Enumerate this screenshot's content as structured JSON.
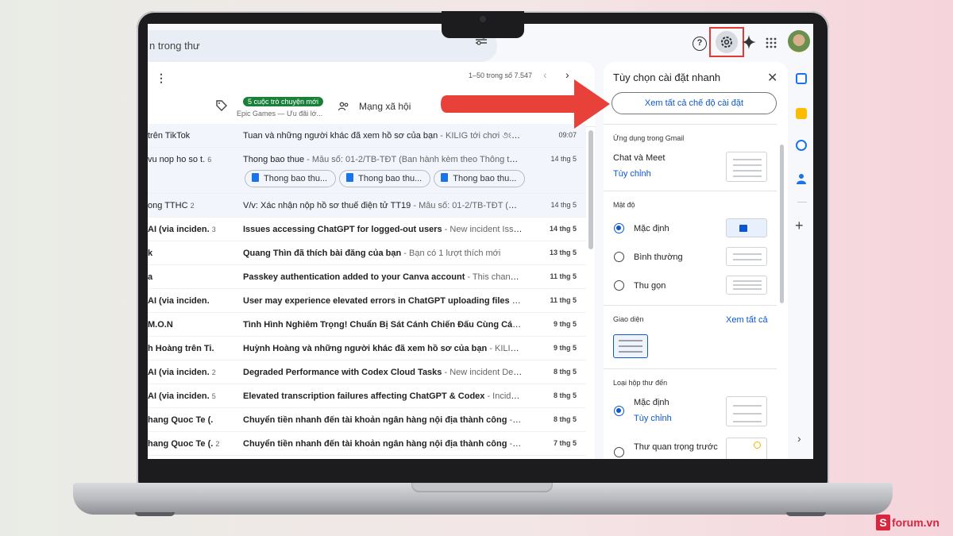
{
  "search": {
    "text": "n trong thư"
  },
  "list": {
    "pager": "1–50 trong số 7.547",
    "tabs": {
      "promo_badge": "5 cuộc trò chuyện mới",
      "promo_sub": "Epic Games — Ưu đãi lớ...",
      "social": "Mạng xã hội"
    },
    "rows": [
      {
        "sender": "trên TikTok",
        "count": "",
        "subject": "Tuan và những người khác đã xem hồ sơ của bạn",
        "snippet": " - KILIG tới chơi ૭ଽ ơi, hồ ...",
        "date": "09:07",
        "unread": false
      },
      {
        "sender": "vu nop ho so t.",
        "count": "6",
        "subject": "Thong bao thue",
        "snippet": " - Mẫu số: 01-2/TB-TĐT (Ban hành kèm theo Thông tư số 1...",
        "date": "14 thg 5",
        "unread": false
      },
      {
        "sender": "ong TTHC",
        "count": "2",
        "subject": "V/v: Xác nhận nộp hồ sơ thuế điện tử TT19",
        "snippet": " - Mẫu số: 01-2/TB-TĐT (Ban hàn...",
        "date": "14 thg 5",
        "unread": false
      },
      {
        "sender": "AI (via inciden.",
        "count": "3",
        "subject": "Issues accessing ChatGPT for logged-out users",
        "snippet": " - New incident Issues a...",
        "date": "14 thg 5",
        "unread": true
      },
      {
        "sender": "k",
        "count": "",
        "subject": "Quang Thìn đã thích bài đăng của bạn",
        "snippet": " - Bạn có 1 lượt thích mới",
        "date": "13 thg 5",
        "unread": true
      },
      {
        "sender": "a",
        "count": "",
        "subject": "Passkey authentication added to your Canva account",
        "snippet": " - This change is ...",
        "date": "11 thg 5",
        "unread": true
      },
      {
        "sender": "AI (via inciden.",
        "count": "",
        "subject": "User may experience elevated errors in ChatGPT uploading files and ...",
        "snippet": "",
        "date": "11 thg 5",
        "unread": true
      },
      {
        "sender": "M.O.N",
        "count": "",
        "subject": "Tình Hình Nghiêm Trọng! Chuẩn Bị Sát Cánh Chiến Đấu Cùng Các Đồn...",
        "snippet": "",
        "date": "9 thg 5",
        "unread": true
      },
      {
        "sender": "h Hoàng trên Ti.",
        "count": "",
        "subject": "Huỳnh Hoàng và những người khác đã xem hồ sơ của bạn",
        "snippet": " - KILIG tới ch...",
        "date": "9 thg 5",
        "unread": true
      },
      {
        "sender": "AI (via inciden.",
        "count": "2",
        "subject": "Degraded Performance with Codex Cloud Tasks",
        "snippet": " - New incident Degrad...",
        "date": "8 thg 5",
        "unread": true
      },
      {
        "sender": "AI (via inciden.",
        "count": "5",
        "subject": "Elevated transcription failures affecting ChatGPT & Codex",
        "snippet": " - Incident u...",
        "date": "8 thg 5",
        "unread": true
      },
      {
        "sender": "hang Quoc Te (.",
        "count": "",
        "subject": "Chuyển tiền nhanh đến tài khoản ngân hàng nội địa thành công",
        "snippet": " - Chu...",
        "date": "8 thg 5",
        "unread": true
      },
      {
        "sender": "hang Quoc Te (.",
        "count": "2",
        "subject": "Chuyển tiền nhanh đến tài khoản ngân hàng nội địa thành công",
        "snippet": " - Chu...",
        "date": "7 thg 5",
        "unread": true
      }
    ],
    "chips": [
      "Thong bao thu...",
      "Thong bao thu...",
      "Thong bao thu..."
    ]
  },
  "settings": {
    "title": "Tùy chọn cài đặt nhanh",
    "see_all": "Xem tất cả chế độ cài đặt",
    "apps_head": "Ứng dụng trong Gmail",
    "chat_meet": "Chat và Meet",
    "customize": "Tùy chỉnh",
    "density_head": "Mật độ",
    "density_options": [
      "Mặc định",
      "Bình thường",
      "Thu gọn"
    ],
    "theme_head": "Giao diện",
    "theme_see_all": "Xem tất cả",
    "inbox_head": "Loại hộp thư đến",
    "inbox_default": "Mặc định",
    "inbox_customize": "Tùy chỉnh",
    "inbox_importance": "Thư quan trọng trước"
  },
  "colors": {
    "accent": "#0b57d0",
    "highlight": "#e53935",
    "arrow": "#e8413a",
    "badge": "#188038"
  },
  "icons": [
    "filter-icon",
    "help-icon",
    "gear-icon",
    "gemini-icon",
    "apps-icon",
    "tag-icon",
    "people-icon",
    "close-icon",
    "calendar-icon",
    "keep-icon",
    "tasks-icon",
    "contacts-icon",
    "plus-icon",
    "chevron-right-icon"
  ],
  "brand": {
    "logo_s": "S",
    "logo_text": "forum.vn"
  }
}
